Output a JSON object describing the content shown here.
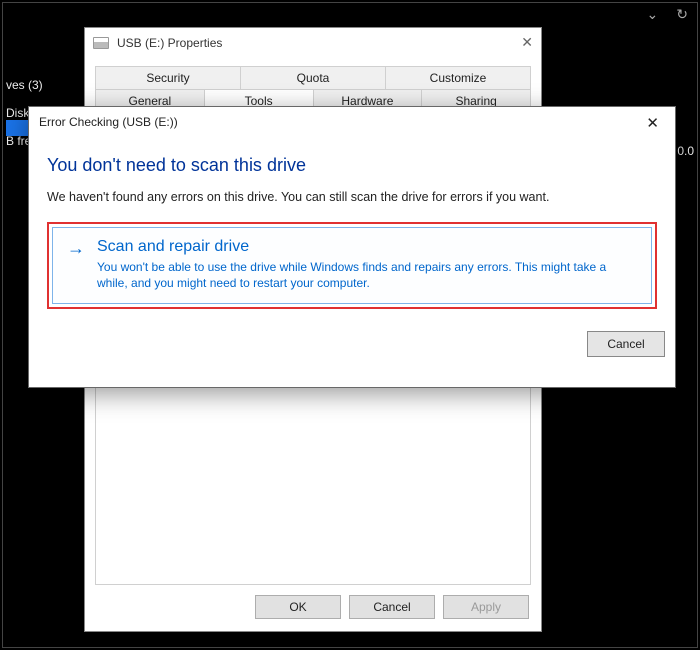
{
  "topbar": {
    "chevron": "⌄",
    "refresh": "↻"
  },
  "darkPanel": {
    "drivesLabel": "ves (3)",
    "diskLabel": "Disk",
    "freeLabel": "B fre",
    "rightValue": "0.0"
  },
  "properties": {
    "title": "USB (E:) Properties",
    "tabsRow1": [
      "Security",
      "Quota",
      "Customize"
    ],
    "tabsRow2": [
      "General",
      "Tools",
      "Hardware",
      "Sharing"
    ],
    "activeTab": "Tools",
    "buttons": {
      "ok": "OK",
      "cancel": "Cancel",
      "apply": "Apply"
    }
  },
  "dialog": {
    "title": "Error Checking (USB (E:))",
    "heading": "You don't need to scan this drive",
    "message": "We haven't found any errors on this drive. You can still scan the drive for errors if you want.",
    "action": {
      "title": "Scan and repair drive",
      "desc": "You won't be able to use the drive while Windows finds and repairs any errors. This might take a while, and you might need to restart your computer."
    },
    "cancel": "Cancel"
  }
}
